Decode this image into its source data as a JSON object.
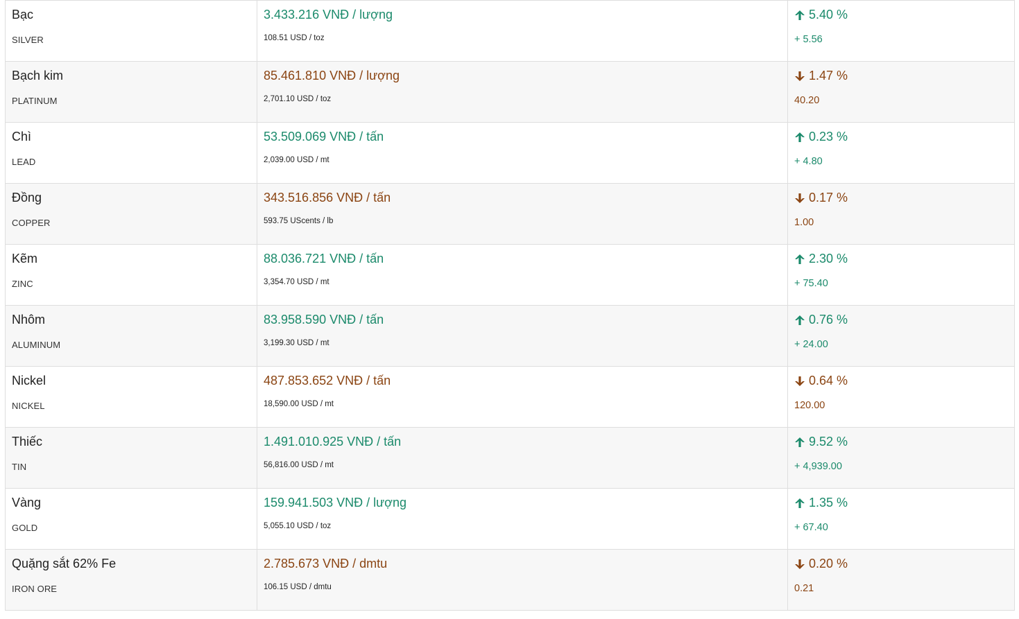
{
  "colors": {
    "up": "#1b8a6b",
    "down": "#8b4513"
  },
  "rows": [
    {
      "name": "Bạc",
      "code": "SILVER",
      "vnd": "3.433.216 VNĐ / lượng",
      "usd": "108.51 USD / toz",
      "direction": "up",
      "arrow_icon": "arrow-up-icon",
      "pct": "5.40 %",
      "change": "+ 5.56"
    },
    {
      "name": "Bạch kim",
      "code": "PLATINUM",
      "vnd": "85.461.810 VNĐ / lượng",
      "usd": "2,701.10 USD / toz",
      "direction": "down",
      "arrow_icon": "arrow-down-icon",
      "pct": "1.47 %",
      "change": "40.20"
    },
    {
      "name": "Chì",
      "code": "LEAD",
      "vnd": "53.509.069 VNĐ / tấn",
      "usd": "2,039.00 USD / mt",
      "direction": "up",
      "arrow_icon": "arrow-up-icon",
      "pct": "0.23 %",
      "change": "+ 4.80"
    },
    {
      "name": "Đồng",
      "code": "COPPER",
      "vnd": "343.516.856 VNĐ / tấn",
      "usd": "593.75 UScents / lb",
      "direction": "down",
      "arrow_icon": "arrow-down-icon",
      "pct": "0.17 %",
      "change": "1.00"
    },
    {
      "name": "Kẽm",
      "code": "ZINC",
      "vnd": "88.036.721 VNĐ / tấn",
      "usd": "3,354.70 USD / mt",
      "direction": "up",
      "arrow_icon": "arrow-up-icon",
      "pct": "2.30 %",
      "change": "+ 75.40"
    },
    {
      "name": "Nhôm",
      "code": "ALUMINUM",
      "vnd": "83.958.590 VNĐ / tấn",
      "usd": "3,199.30 USD / mt",
      "direction": "up",
      "arrow_icon": "arrow-up-icon",
      "pct": "0.76 %",
      "change": "+ 24.00"
    },
    {
      "name": "Nickel",
      "code": "NICKEL",
      "vnd": "487.853.652 VNĐ / tấn",
      "usd": "18,590.00 USD / mt",
      "direction": "down",
      "arrow_icon": "arrow-down-icon",
      "pct": "0.64 %",
      "change": "120.00"
    },
    {
      "name": "Thiếc",
      "code": "TIN",
      "vnd": "1.491.010.925 VNĐ / tấn",
      "usd": "56,816.00 USD / mt",
      "direction": "up",
      "arrow_icon": "arrow-up-icon",
      "pct": "9.52 %",
      "change": "+ 4,939.00"
    },
    {
      "name": "Vàng",
      "code": "GOLD",
      "vnd": "159.941.503 VNĐ / lượng",
      "usd": "5,055.10 USD / toz",
      "direction": "up",
      "arrow_icon": "arrow-up-icon",
      "pct": "1.35 %",
      "change": "+ 67.40"
    },
    {
      "name": "Quặng sắt 62% Fe",
      "code": "IRON ORE",
      "vnd": "2.785.673 VNĐ / dmtu",
      "usd": "106.15 USD / dmtu",
      "direction": "down",
      "arrow_icon": "arrow-down-icon",
      "pct": "0.20 %",
      "change": "0.21"
    }
  ]
}
